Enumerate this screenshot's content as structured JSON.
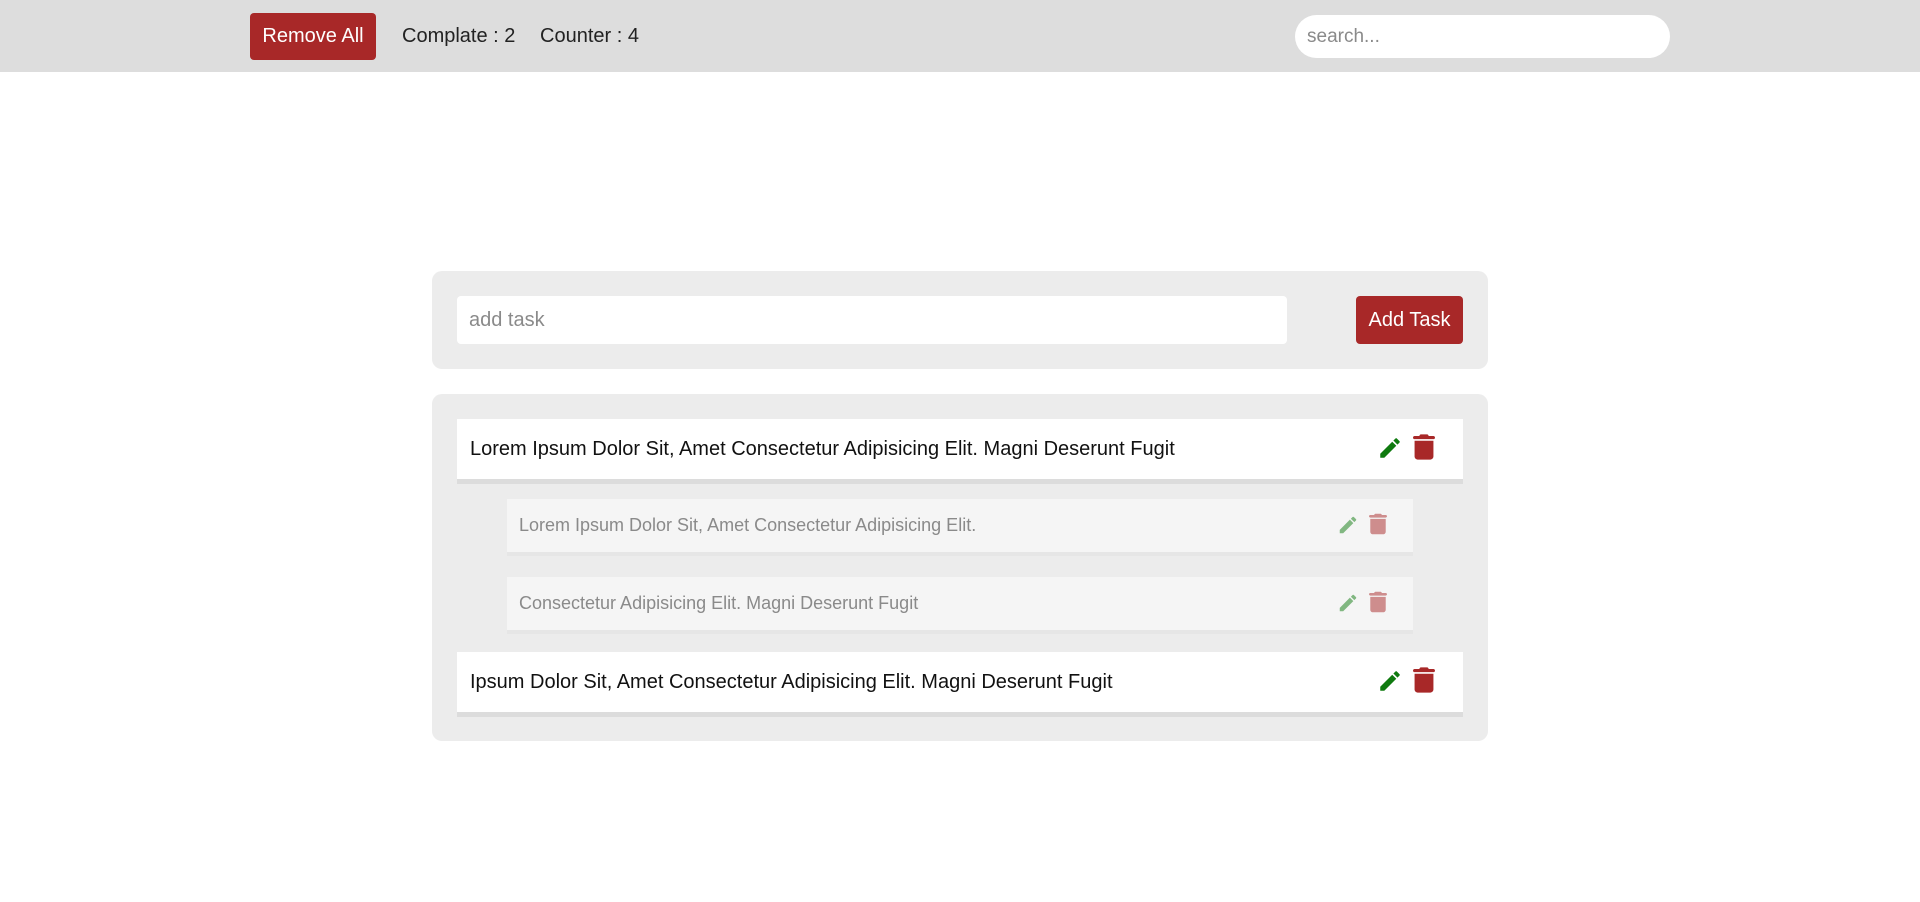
{
  "header": {
    "remove_all_label": "Remove All",
    "complete_text": "Complate : 2",
    "counter_text": "Counter : 4",
    "search_placeholder": "search..."
  },
  "add_form": {
    "input_placeholder": "add task",
    "add_button_label": "Add Task"
  },
  "tasks": [
    {
      "text": "Lorem Ipsum Dolor Sit, Amet Consectetur Adipisicing Elit. Magni Deserunt Fugit",
      "completed": false,
      "subtasks": [
        {
          "text": "Lorem Ipsum Dolor Sit, Amet Consectetur Adipisicing Elit.",
          "completed": true
        },
        {
          "text": "Consectetur Adipisicing Elit. Magni Deserunt Fugit",
          "completed": true
        }
      ]
    },
    {
      "text": "Ipsum Dolor Sit, Amet Consectetur Adipisicing Elit. Magni Deserunt Fugit",
      "completed": false,
      "subtasks": []
    }
  ],
  "icons": {
    "edit": "pencil-icon",
    "delete": "trash-icon"
  },
  "colors": {
    "accent_red": "#a82828",
    "edit_green": "#0f7a0f",
    "topbar_bg": "#dddddd",
    "panel_bg": "#ececec"
  }
}
